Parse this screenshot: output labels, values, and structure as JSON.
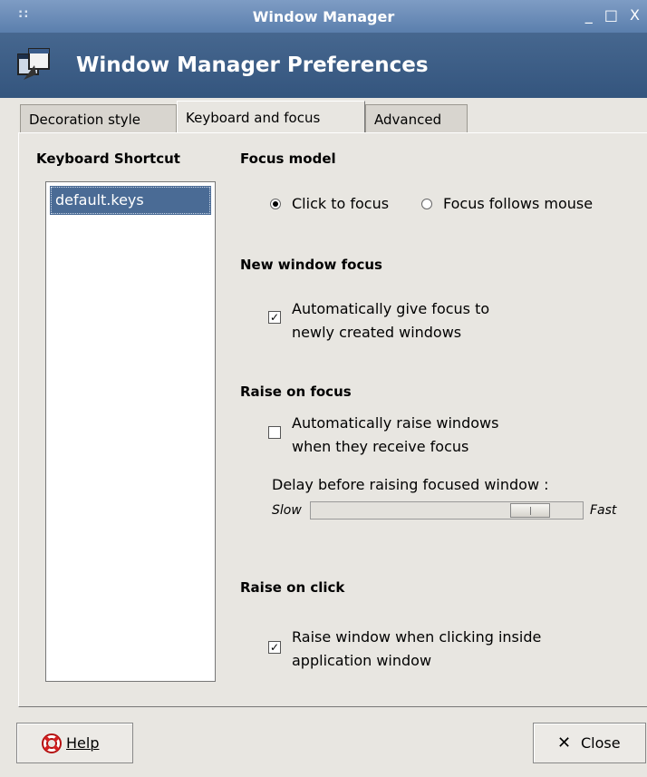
{
  "window": {
    "title": "Window Manager",
    "grip": "::",
    "controls": "_ □ X"
  },
  "header": {
    "title": "Window Manager Preferences",
    "icon": "window-manager-icon"
  },
  "tabs": [
    {
      "label": "Decoration style",
      "active": false
    },
    {
      "label": "Keyboard and focus",
      "active": true
    },
    {
      "label": "Advanced",
      "active": false
    }
  ],
  "keyboard": {
    "title": "Keyboard Shortcut",
    "items": [
      "default.keys"
    ],
    "selected": "default.keys"
  },
  "focus_model": {
    "title": "Focus model",
    "options": [
      {
        "label": "Click to focus",
        "checked": true
      },
      {
        "label": "Focus follows mouse",
        "checked": false
      }
    ]
  },
  "new_window_focus": {
    "title": "New window focus",
    "line1": "Automatically give focus to",
    "line2": "newly created windows",
    "checked": true
  },
  "raise_on_focus": {
    "title": "Raise on focus",
    "line1": "Automatically raise windows",
    "line2": "when they receive focus",
    "checked": false,
    "delay_label": "Delay before raising focused window :",
    "slow": "Slow",
    "fast": "Fast",
    "delay_value_fraction": 0.86
  },
  "raise_on_click": {
    "title": "Raise on click",
    "line1": "Raise window when clicking inside",
    "line2": "application window",
    "checked": true
  },
  "buttons": {
    "help": "Help",
    "close": "Close"
  }
}
